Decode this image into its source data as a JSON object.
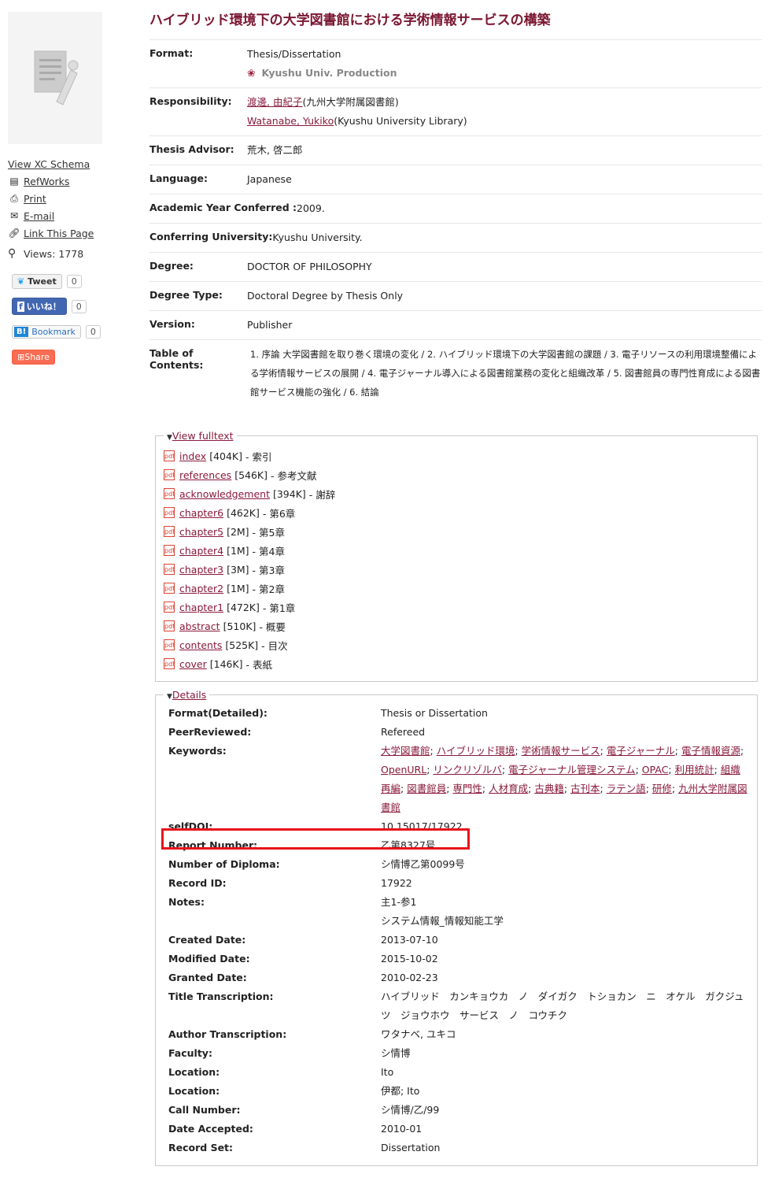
{
  "title": "ハイブリッド環境下の大学図書館における学術情報サービスの構築",
  "sidebar": {
    "tools": [
      {
        "label": "View XC Schema",
        "icon": ""
      },
      {
        "label": "RefWorks",
        "icon": "refworks-icon"
      },
      {
        "label": "Print",
        "icon": "print-icon"
      },
      {
        "label": "E-mail",
        "icon": "email-icon"
      },
      {
        "label": "Link This Page",
        "icon": "link-icon"
      }
    ],
    "views": "Views: 1778",
    "social": {
      "tweet": "Tweet",
      "tweet_count": "0",
      "like": "いいね！",
      "like_count": "0",
      "bookmark": "Bookmark",
      "bookmark_count": "0",
      "share": "Share"
    }
  },
  "fields": {
    "format_label": "Format:",
    "format": "Thesis/Dissertation",
    "production": "Kyushu Univ. Production",
    "responsibility_label": "Responsibility:",
    "author_ja": "渡邊, 由紀子",
    "author_ja_aff": "(九州大学附属図書館)",
    "author_en": "Watanabe, Yukiko",
    "author_en_aff": "(Kyushu University Library)",
    "advisor_label": "Thesis Advisor:",
    "advisor": "荒木, 啓二郎",
    "language_label": "Language:",
    "language": "Japanese",
    "year_label": "Academic Year Conferred :",
    "year": "2009.",
    "university_label": "Conferring University:",
    "university": "Kyushu University.",
    "degree_label": "Degree:",
    "degree": "DOCTOR OF PHILOSOPHY",
    "degree_type_label": "Degree Type:",
    "degree_type": "Doctoral Degree by Thesis Only",
    "version_label": "Version:",
    "version": "Publisher",
    "toc_label": "Table of Contents:",
    "toc": "1. 序論 大学図書館を取り巻く環境の変化 / 2. ハイブリッド環境下の大学図書館の課題 / 3. 電子リソースの利用環境整備による学術情報サービスの展開 / 4. 電子ジャーナル導入による図書館業務の変化と組織改革 / 5. 図書館員の専門性育成による図書館サービス機能の強化 / 6. 結論"
  },
  "fulltext": {
    "legend": "View fulltext",
    "files": [
      {
        "name": "index",
        "size": "[404K]",
        "desc": "- 索引"
      },
      {
        "name": "references",
        "size": "[546K]",
        "desc": "- 参考文献"
      },
      {
        "name": "acknowledgement",
        "size": "[394K]",
        "desc": "- 謝辞"
      },
      {
        "name": "chapter6",
        "size": "[462K]",
        "desc": "- 第6章"
      },
      {
        "name": "chapter5",
        "size": "[2M]",
        "desc": "- 第5章"
      },
      {
        "name": "chapter4",
        "size": "[1M]",
        "desc": "- 第4章"
      },
      {
        "name": "chapter3",
        "size": "[3M]",
        "desc": "- 第3章"
      },
      {
        "name": "chapter2",
        "size": "[1M]",
        "desc": "- 第2章"
      },
      {
        "name": "chapter1",
        "size": "[472K]",
        "desc": "- 第1章"
      },
      {
        "name": "abstract",
        "size": "[510K]",
        "desc": "- 概要"
      },
      {
        "name": "contents",
        "size": "[525K]",
        "desc": "- 目次"
      },
      {
        "name": "cover",
        "size": "[146K]",
        "desc": "- 表紙"
      }
    ]
  },
  "details": {
    "legend": "Details",
    "rows": [
      {
        "label": "Format(Detailed):",
        "value": "Thesis or Dissertation"
      },
      {
        "label": "PeerReviewed:",
        "value": "Refereed"
      },
      {
        "label": "Keywords:",
        "keywords": [
          "大学図書館",
          "ハイブリッド環境",
          "学術情報サービス",
          "電子ジャーナル",
          "電子情報資源",
          "OpenURL",
          "リンクリゾルバ",
          "電子ジャーナル管理システム",
          "OPAC",
          "利用統計",
          "組織再編",
          "図書館員",
          "専門性",
          "人材育成",
          "古典籍",
          "古刊本",
          "ラテン語",
          "研修",
          "九州大学附属図書館"
        ]
      },
      {
        "label": "selfDOI:",
        "value": "10.15017/17922"
      },
      {
        "label": "Report Number:",
        "value": "乙第8327号"
      },
      {
        "label": "Number of Diploma:",
        "value": "シ情博乙第0099号"
      },
      {
        "label": "Record ID:",
        "value": "17922"
      },
      {
        "label": "Notes:",
        "value": "主1-参1",
        "value2": "システム情報_情報知能工学"
      },
      {
        "label": "Created Date:",
        "value": "2013-07-10"
      },
      {
        "label": "Modified Date:",
        "value": "2015-10-02"
      },
      {
        "label": "Granted Date:",
        "value": "2010-02-23"
      },
      {
        "label": "Title Transcription:",
        "value": "ハイブリッド　カンキョウカ　ノ　ダイガク　トショカン　ニ　オケル　ガクジュツ　ジョウホウ　サービス　ノ　コウチク"
      },
      {
        "label": "Author Transcription:",
        "value": "ワタナベ, ユキコ"
      },
      {
        "label": "Faculty:",
        "value": "シ情博"
      },
      {
        "label": "Location:",
        "value": "Ito"
      },
      {
        "label": "Location:",
        "value": "伊都; Ito"
      },
      {
        "label": "Call Number:",
        "value": "シ情博/乙/99"
      },
      {
        "label": "Date Accepted:",
        "value": "2010-01"
      },
      {
        "label": "Record Set:",
        "value": "Dissertation"
      }
    ]
  }
}
